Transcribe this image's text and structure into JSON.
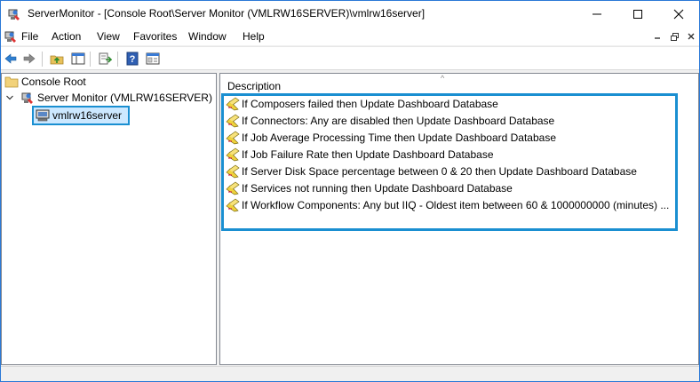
{
  "window": {
    "title": "ServerMonitor - [Console Root\\Server Monitor (VMLRW16SERVER)\\vmlrw16server]"
  },
  "menu": {
    "items": [
      "File",
      "Action",
      "View",
      "Favorites",
      "Window",
      "Help"
    ]
  },
  "toolbar": {
    "buttons": [
      "back-icon",
      "forward-icon",
      "up-folder-icon",
      "show-hide-tree-icon",
      "export-list-icon",
      "help-icon",
      "properties-icon"
    ]
  },
  "tree": {
    "root_label": "Console Root",
    "server_label": "Server Monitor (VMLRW16SERVER)",
    "selected_label": "vmlrw16server"
  },
  "list": {
    "column_header": "Description",
    "sort_glyph": "^",
    "items": [
      "If Composers failed then Update Dashboard Database",
      "If Connectors: Any are disabled then Update Dashboard Database",
      "If Job Average Processing Time then Update Dashboard Database",
      "If Job Failure Rate then Update Dashboard Database",
      "If Server Disk Space percentage between 0 & 20 then Update Dashboard Database",
      "If Services not running then Update Dashboard Database",
      "If Workflow Components: Any but IIQ - Oldest item between 60 & 1000000000 (minutes) ..."
    ]
  },
  "colors": {
    "accent_highlight": "#1a8fd1",
    "selection_fill": "#cce8ff",
    "pane_border": "#828790"
  }
}
